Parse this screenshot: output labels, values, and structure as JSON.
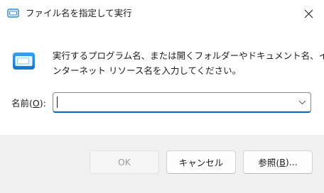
{
  "window": {
    "title": "ファイル名を指定して実行"
  },
  "description": {
    "line1": "実行するプログラム名、または開くフォルダーやドキュメント名、イ",
    "line2": "ンターネット リソース名を入力してください。"
  },
  "open_field": {
    "label_prefix": "名前(",
    "label_access_key": "O",
    "label_suffix": "):",
    "value": ""
  },
  "buttons": {
    "ok": "OK",
    "cancel": "キャンセル",
    "browse_prefix": "参照(",
    "browse_access_key": "B",
    "browse_suffix": ")..."
  },
  "colors": {
    "accent": "#0067c0",
    "footer_background": "#f0f0f0",
    "disabled_text": "#9d9d9d"
  },
  "icons": {
    "title": "run-dialog-icon",
    "close": "close-icon",
    "main": "run-program-icon",
    "dropdown": "chevron-down-icon"
  }
}
